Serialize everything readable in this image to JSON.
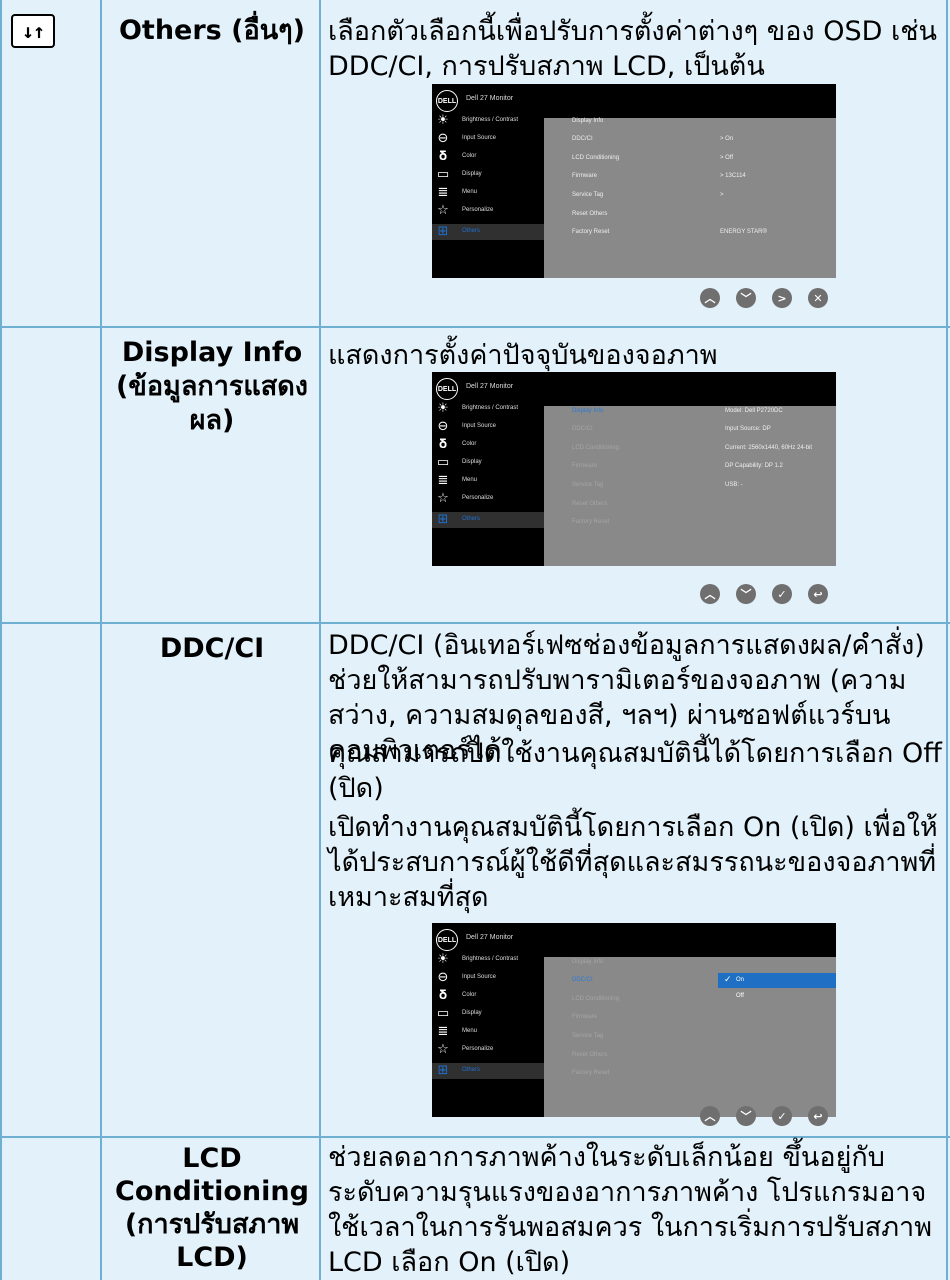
{
  "rows": [
    {
      "label": "Others (อื่นๆ)",
      "desc": [
        "เลือกตัวเลือกนี้เพื่อปรับการตั้งค่าต่างๆ ของ OSD เช่น DDC/CI, การปรับสภาพ LCD, เป็นต้น"
      ]
    },
    {
      "label": "Display Info (ข้อมูลการแสดงผล)",
      "desc": [
        "แสดงการตั้งค่าปัจจุบันของจอภาพ"
      ]
    },
    {
      "label": "DDC/CI",
      "desc": [
        "DDC/CI (อินเทอร์เฟซช่องข้อมูลการแสดงผล/คำสั่ง) ช่วยให้สามารถปรับพารามิเตอร์ของจอภาพ (ความสว่าง, ความสมดุลของสี, ฯลฯ) ผ่านซอฟต์แวร์บนคอมพิวเตอร์ได้",
        "คุณสามารถปิดใช้งานคุณสมบัตินี้ได้โดยการเลือก Off (ปิด)",
        "เปิดทำงานคุณสมบัตินี้โดยการเลือก On (เปิด) เพื่อให้ได้ประสบการณ์ผู้ใช้ดีที่สุดและสมรรถนะของจอภาพที่เหมาะสมที่สุด"
      ]
    },
    {
      "label": "LCD Conditioning (การปรับสภาพ LCD)",
      "desc": [
        "ช่วยลดอาการภาพค้างในระดับเล็กน้อย ขึ้นอยู่กับระดับความรุนแรงของอาการภาพค้าง โปรแกรมอาจใช้เวลาในการรันพอสมควร ในการเริ่มการปรับสภาพ LCD เลือก On (เปิด)"
      ]
    }
  ],
  "osd": {
    "logo": "DELL",
    "model": "Dell 27 Monitor",
    "menu": [
      "Brightness / Contrast",
      "Input Source",
      "Color",
      "Display",
      "Menu",
      "Personalize",
      "Others"
    ],
    "menu_icons": [
      "brightness-icon",
      "input-source-icon",
      "color-icon",
      "display-icon",
      "menu-icon",
      "personalize-icon",
      "others-icon"
    ],
    "submenu": [
      "Display Info",
      "DDC/CI",
      "LCD Conditioning",
      "Firmware",
      "Service Tag",
      "Reset Others",
      "Factory Reset"
    ],
    "screen1_values": [
      "> On",
      "> Off",
      "> 13C114",
      ">",
      "ENERGY STAR®"
    ],
    "screen2_values": [
      "Model: Dell P2720DC",
      "Input Source: DP",
      "Current: 2560x1440, 60Hz 24-bit",
      "DP Capability: DP 1.2",
      "USB: -"
    ],
    "screen3_options": [
      "On",
      "Off"
    ]
  },
  "colors": {
    "background": "#e3f2fa",
    "grid": "#6fb0d2",
    "highlight": "#1f6fc4",
    "osd_panel": "#898989"
  }
}
